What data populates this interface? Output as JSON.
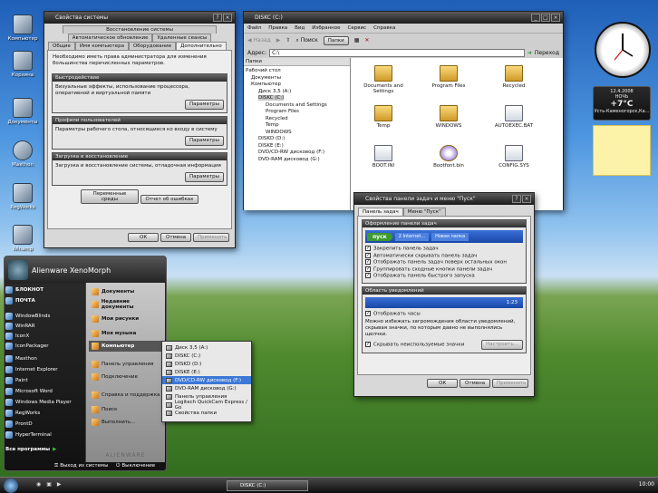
{
  "desktop": {
    "icons": [
      "Компьютер",
      "Корзина",
      "Документы",
      "Maxthon",
      "RegWorks",
      "Winamp"
    ]
  },
  "sysprops": {
    "title": "Свойства системы",
    "tabs_row1": [
      "Восстановление системы"
    ],
    "tabs_row2": [
      "Автоматическое обновление",
      "Удаленные сеансы"
    ],
    "tabs_row3": [
      "Общие",
      "Имя компьютера",
      "Оборудование",
      "Дополнительно"
    ],
    "intro": "Необходимо иметь права администратора для изменения большинства перечисленных параметров.",
    "groups": [
      {
        "title": "Быстродействие",
        "text": "Визуальные эффекты, использование процессора, оперативной и виртуальной памяти",
        "button": "Параметры"
      },
      {
        "title": "Профили пользователей",
        "text": "Параметры рабочего стола, относящиеся ко входу в систему",
        "button": "Параметры"
      },
      {
        "title": "Загрузка и восстановление",
        "text": "Загрузка и восстановление системы, отладочная информация",
        "button": "Параметры"
      }
    ],
    "env_button": "Переменные среды",
    "errors_button": "Отчет об ошибках",
    "ok": "ОК",
    "cancel": "Отмена",
    "apply": "Применить"
  },
  "explorer": {
    "title": "DISKC (C:)",
    "menu": [
      "Файл",
      "Правка",
      "Вид",
      "Избранное",
      "Сервис",
      "Справка"
    ],
    "toolbar": {
      "back": "Назад",
      "search": "Поиск",
      "folders": "Папки"
    },
    "address_label": "Адрес:",
    "address_value": "C:\\",
    "go": "Переход",
    "folders_pane_title": "Папки",
    "tree": [
      "Рабочий стол",
      "Документы",
      "Компьютер",
      "Диск 3,5 (A:)",
      "DISKC (C:)",
      "Documents and Settings",
      "Program Files",
      "Recycled",
      "Temp",
      "WINDOWS",
      "DISKD (D:)",
      "DISKE (E:)",
      "DVD/CD-RW дисковод (F:)",
      "DVD-RAM дисковод (G:)"
    ],
    "files": [
      "Documents and Settings",
      "Program Files",
      "Recycled",
      "Temp",
      "WINDOWS",
      "AUTOEXEC.BAT",
      "BOOT.INI",
      "Bootfont.bin",
      "CONFIG.SYS"
    ]
  },
  "taskbar_props": {
    "title": "Свойства панели задач и меню \"Пуск\"",
    "tabs": [
      "Панель задач",
      "Меню \"Пуск\""
    ],
    "group1_title": "Оформление панели задач",
    "preview_start": "пуск",
    "preview_item1": "2 Internet...",
    "preview_item2": "Новая папка",
    "options1": [
      {
        "label": "Закрепить панель задач",
        "checked": true
      },
      {
        "label": "Автоматически скрывать панель задач",
        "checked": true
      },
      {
        "label": "Отображать панель задач поверх остальных окон",
        "checked": true
      },
      {
        "label": "Группировать сходные кнопки панели задач",
        "checked": true
      },
      {
        "label": "Отображать панель быстрого запуска",
        "checked": true
      }
    ],
    "group2_title": "Область уведомлений",
    "tray_time": "1:23",
    "options2": [
      {
        "label": "Отображать часы",
        "checked": true
      }
    ],
    "note": "Можно избежать загромождения области уведомлений, скрывая значки, по которым давно не выполнялись щелчки.",
    "hide_icons": {
      "label": "Скрывать неиспользуемые значки",
      "checked": true
    },
    "customize": "Настроить...",
    "ok": "ОК",
    "cancel": "Отмена",
    "apply": "Применить"
  },
  "gadgets": {
    "date": "12.4.2008",
    "part_of_day": "НОЧЬ",
    "temp": "+7°C",
    "city": "Усть-Каменогорск,Ка..."
  },
  "startmenu": {
    "user": "Alienware XenoMorph",
    "pinned": [
      "БЛОКНОТ",
      "ПОЧТА"
    ],
    "left_items": [
      "WindowBlinds",
      "WinRAR",
      "IconX",
      "IconPackager",
      "Maxthon",
      "Internet Explorer",
      "Paint",
      "Microsoft Word",
      "Windows Media Player",
      "RegWorks",
      "ProntD",
      "HyperTerminal"
    ],
    "all_programs": "Все программы",
    "right_items": [
      "Документы",
      "Недавние документы",
      "Мои рисунки",
      "Моя музыка",
      "Компьютер",
      "Панель управления",
      "Подключение",
      "Справка и поддержка",
      "Поиск",
      "Выполнить..."
    ],
    "brand": "ALIENWARE",
    "logoff": "Выход из системы",
    "shutdown": "Выключение"
  },
  "submenu": {
    "items": [
      "Диск 3,5 (A:)",
      "DISKC (C:)",
      "DISKD (D:)",
      "DISKE (E:)",
      "DVD/CD-RW дисковод (F:)",
      "DVD-RAM дисковод (G:)",
      "Панель управления",
      "Logitech QuickCam Express / Go",
      "Свойства папки"
    ],
    "highlighted": "DVD/CD-RW дисковод (F:)"
  },
  "taskbar": {
    "task": "DISKC (C:)",
    "clock": "10:00"
  },
  "colors": {
    "accent": "#2f7fd0",
    "dark": "#1c1c1c",
    "highlight": "#3c78d8"
  }
}
